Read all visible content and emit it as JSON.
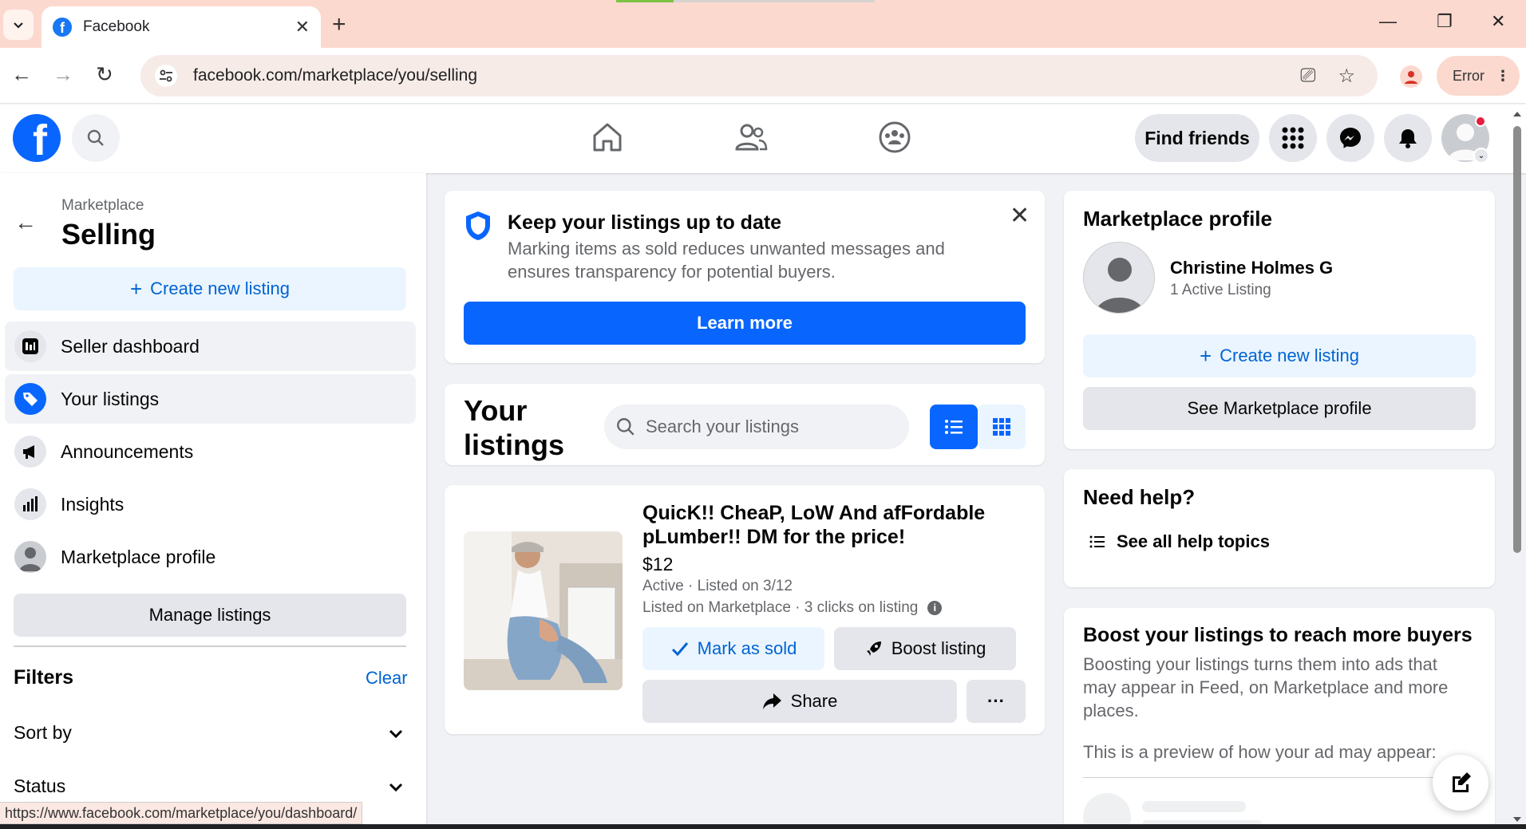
{
  "browser": {
    "tab_title": "Facebook",
    "url": "facebook.com/marketplace/you/selling",
    "error_label": "Error",
    "status_url": "https://www.facebook.com/marketplace/you/dashboard/"
  },
  "topnav": {
    "find_friends": "Find friends"
  },
  "sidebar": {
    "breadcrumb": "Marketplace",
    "title": "Selling",
    "create_listing": "Create new listing",
    "items": [
      {
        "label": "Seller dashboard",
        "icon": "dashboard-icon"
      },
      {
        "label": "Your listings",
        "icon": "tag-icon"
      },
      {
        "label": "Announcements",
        "icon": "megaphone-icon"
      },
      {
        "label": "Insights",
        "icon": "bar-chart-icon"
      },
      {
        "label": "Marketplace profile",
        "icon": "user-icon"
      }
    ],
    "manage_listings": "Manage listings",
    "filters": "Filters",
    "clear": "Clear",
    "sort_by": "Sort by",
    "status": "Status"
  },
  "tip": {
    "title": "Keep your listings up to date",
    "text": "Marking items as sold reduces unwanted messages and ensures transparency for potential buyers.",
    "learn_more": "Learn more"
  },
  "your_listings": {
    "title": "Your listings",
    "search_placeholder": "Search your listings"
  },
  "listing": {
    "title": "QuicK!! CheaP, LoW And afFordable pLumber!! DM for the price!",
    "price": "$12",
    "meta1": "Active · Listed on 3/12",
    "meta2": "Listed on Marketplace · 3 clicks on listing",
    "mark_sold": "Mark as sold",
    "boost": "Boost listing",
    "share": "Share",
    "more": "···"
  },
  "profile": {
    "title": "Marketplace profile",
    "name": "Christine Holmes G",
    "sub": "1 Active Listing",
    "create_listing": "Create new listing",
    "see_profile": "See Marketplace profile"
  },
  "help": {
    "title": "Need help?",
    "link": "See all help topics"
  },
  "boost": {
    "title": "Boost your listings to reach more buyers",
    "text": "Boosting your listings turns them into ads that may appear in Feed, on Marketplace and more places.",
    "preview": "This is a preview of how your ad may appear:"
  },
  "colors": {
    "fb_blue": "#0866ff",
    "link_blue": "#0064d1",
    "light_blue_bg": "#ebf5ff",
    "chrome_tab": "#fbd9cf"
  }
}
